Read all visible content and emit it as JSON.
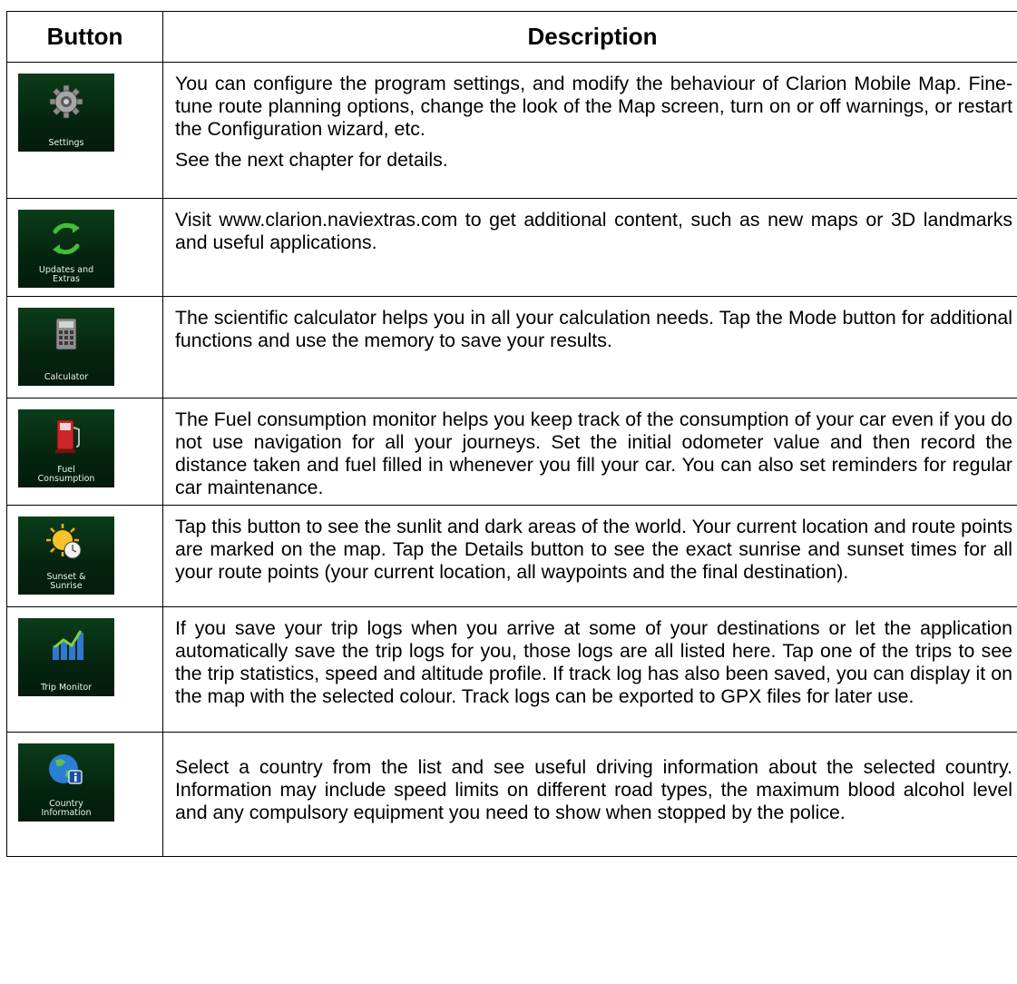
{
  "headers": {
    "button": "Button",
    "description": "Description"
  },
  "rows": [
    {
      "icon": "settings-gear-icon",
      "label": "Settings",
      "paragraphs": [
        "You can configure the program settings, and modify the behaviour of Clarion Mobile Map. Fine-tune route planning options, change the look of the Map screen, turn on or off warnings, or restart the Configuration wizard, etc.",
        "See the next chapter for details."
      ]
    },
    {
      "icon": "updates-refresh-icon",
      "label_lines": [
        "Updates and",
        "Extras"
      ],
      "paragraphs": [
        "Visit www.clarion.naviextras.com to get additional content, such as new maps or 3D landmarks and useful applications."
      ]
    },
    {
      "icon": "calculator-icon",
      "label": "Calculator",
      "paragraphs": [
        "The scientific calculator helps you in all your calculation needs. Tap the Mode button for additional functions and use the memory to save your results."
      ]
    },
    {
      "icon": "fuel-pump-icon",
      "label_lines": [
        "Fuel",
        "Consumption"
      ],
      "paragraphs": [
        "The Fuel consumption monitor helps you keep track of the consumption of your car even if you do not use navigation for all your journeys. Set the initial odometer value and then record the distance taken and fuel filled in whenever you fill your car. You can also set reminders for regular car maintenance."
      ]
    },
    {
      "icon": "sun-clock-icon",
      "label_lines": [
        "Sunset &",
        "Sunrise"
      ],
      "paragraphs": [
        "Tap this button to see the sunlit and dark areas of the world. Your current location and route points are marked on the map. Tap the Details button to see the exact sunrise and sunset times for all your route points (your current location, all waypoints and the final destination)."
      ]
    },
    {
      "icon": "trip-chart-icon",
      "label": "Trip Monitor",
      "paragraphs": [
        "If you save your trip logs when you arrive at some of your destinations or let the application automatically save the trip logs for you, those logs are all listed here. Tap one of the trips to see the trip statistics, speed and altitude profile. If track log has also been saved, you can display it on the map with the selected colour. Track logs can be exported to GPX files for later use."
      ]
    },
    {
      "icon": "globe-info-icon",
      "label_lines": [
        "Country",
        "Information"
      ],
      "paragraphs": [
        "Select a country from the list and see useful driving information about the selected country. Information may include speed limits on different road types, the maximum blood alcohol level and any compulsory equipment you need to show when stopped by the police."
      ]
    }
  ]
}
